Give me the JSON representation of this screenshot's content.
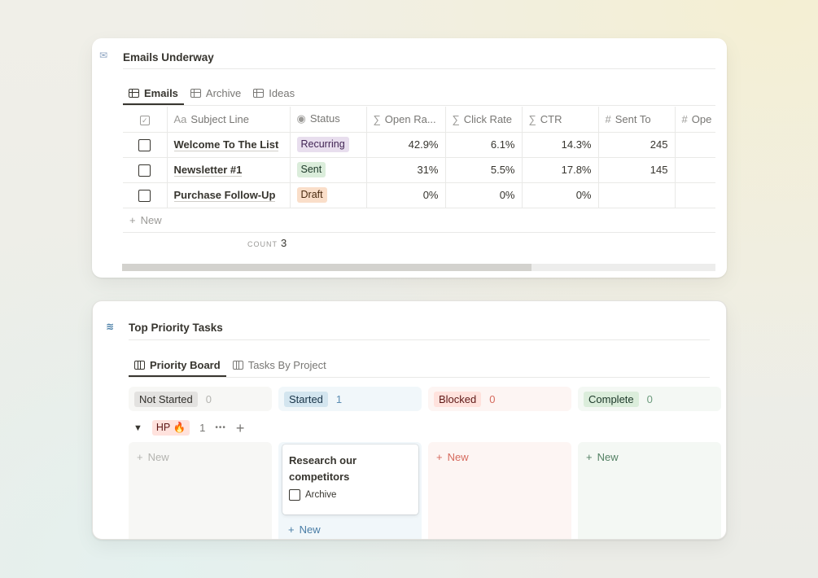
{
  "emails": {
    "title": "Emails Underway",
    "icon": "envelope-icon",
    "tabs": [
      {
        "label": "Emails",
        "icon": "table-icon",
        "active": true
      },
      {
        "label": "Archive",
        "icon": "table-icon",
        "active": false
      },
      {
        "label": "Ideas",
        "icon": "table-icon",
        "active": false
      }
    ],
    "columns": [
      {
        "icon": "Aa",
        "label": "Subject Line"
      },
      {
        "icon": "◉",
        "label": "Status"
      },
      {
        "icon": "∑",
        "label": "Open Ra..."
      },
      {
        "icon": "∑",
        "label": "Click Rate"
      },
      {
        "icon": "∑",
        "label": "CTR"
      },
      {
        "icon": "#",
        "label": "Sent To"
      },
      {
        "icon": "#",
        "label": "Ope"
      }
    ],
    "rows": [
      {
        "subject": "Welcome To The List",
        "status": "Recurring",
        "open_rate": "42.9%",
        "click_rate": "6.1%",
        "ctr": "14.3%",
        "sent_to": "245",
        "opens": ""
      },
      {
        "subject": "Newsletter #1",
        "status": "Sent",
        "open_rate": "31%",
        "click_rate": "5.5%",
        "ctr": "17.8%",
        "sent_to": "145",
        "opens": ""
      },
      {
        "subject": "Purchase Follow-Up",
        "status": "Draft",
        "open_rate": "0%",
        "click_rate": "0%",
        "ctr": "0%",
        "sent_to": "",
        "opens": ""
      }
    ],
    "new_label": "New",
    "count_label": "COUNT",
    "count_value": "3",
    "scroll_fraction": 0.69
  },
  "tasks": {
    "title": "Top Priority Tasks",
    "icon": "stack-icon",
    "tabs": [
      {
        "label": "Priority Board",
        "icon": "board-icon",
        "active": true
      },
      {
        "label": "Tasks By Project",
        "icon": "board-icon",
        "active": false
      }
    ],
    "columns": [
      {
        "label": "Not Started",
        "count": "0",
        "new_label": "New"
      },
      {
        "label": "Started",
        "count": "1",
        "new_label": "New"
      },
      {
        "label": "Blocked",
        "count": "0",
        "new_label": "New"
      },
      {
        "label": "Complete",
        "count": "0",
        "new_label": "New"
      }
    ],
    "group": {
      "label": "HP",
      "emoji": "🔥",
      "count": "1",
      "more": "•••",
      "add": "+"
    },
    "card": {
      "title": "Research our competitors",
      "checkbox_label": "Archive"
    }
  },
  "colors": {
    "recurring_bg": "#e8deee",
    "sent_bg": "#dbeddb",
    "draft_bg": "#fadec9",
    "not_started_bg": "#e3e2e0",
    "started_bg": "#d3e5ef",
    "blocked_bg": "#ffe2dd",
    "complete_bg": "#dbeddb"
  }
}
